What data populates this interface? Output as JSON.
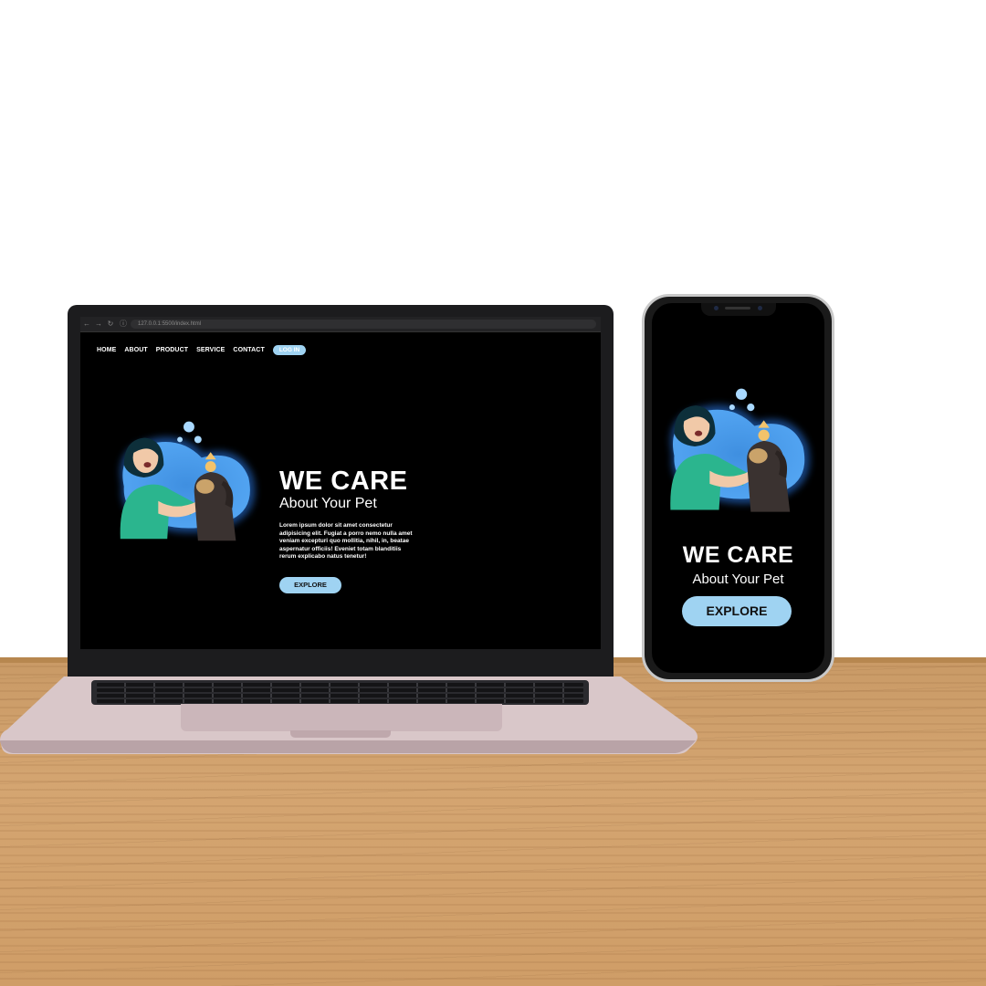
{
  "browser": {
    "back_icon": "back-arrow-icon",
    "forward_icon": "forward-arrow-icon",
    "reload_icon": "reload-icon",
    "url": "127.0.0.1:5500/index.html"
  },
  "site": {
    "nav": {
      "home": "HOME",
      "about": "ABOUT",
      "product": "PRODUCT",
      "service": "SERVICE",
      "contact": "CONTACT",
      "login": "LOG IN"
    },
    "hero": {
      "title": "WE CARE",
      "subtitle": "About Your Pet",
      "body": "Lorem ipsum dolor sit amet consectetur adipisicing elit. Fugiat a porro nemo nulla amet veniam excepturi quo mollitia, nihil, in, beatae aspernatur officiis! Eveniet totam blanditiis rerum explicabo natus tenetur!",
      "cta": "EXPLORE"
    },
    "illustration": "woman-holding-dog-illustration"
  },
  "mobile": {
    "title": "WE CARE",
    "subtitle": "About Your Pet",
    "cta": "EXPLORE"
  },
  "colors": {
    "accent": "#9fd3f2",
    "page_background": "#000000",
    "text": "#ffffff"
  }
}
